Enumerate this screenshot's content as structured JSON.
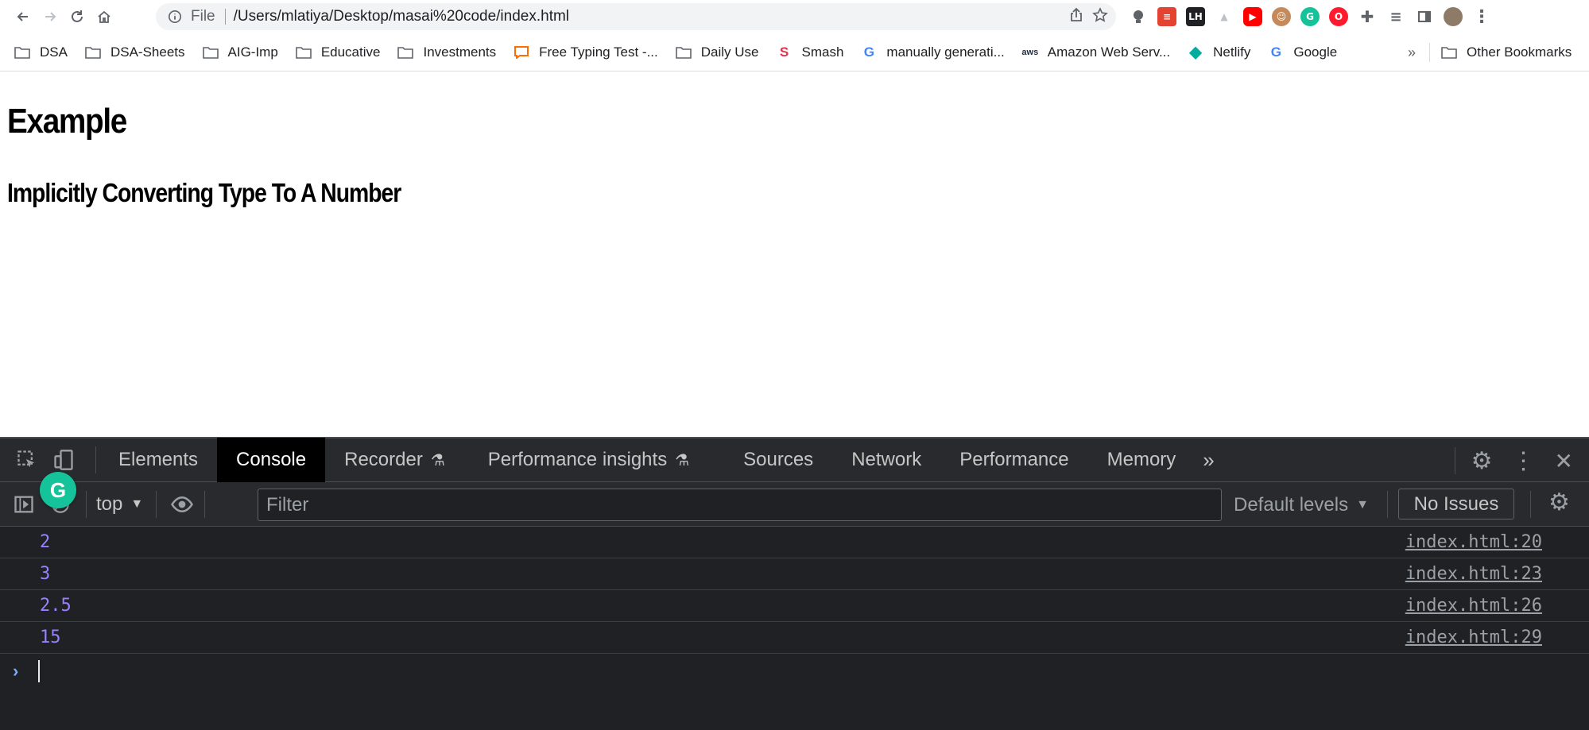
{
  "browser": {
    "omnibox": {
      "scheme_label": "File",
      "url": "/Users/mlatiya/Desktop/masai%20code/index.html"
    },
    "extensions": [
      {
        "icon": "lightbulb-icon",
        "color": "#5f6368"
      },
      {
        "icon": "todoist-icon",
        "color": "#e44332"
      },
      {
        "icon": "lighthouse-icon",
        "color": "#202124",
        "label": "LH"
      },
      {
        "icon": "drive-icon",
        "color": "#bdc1c6"
      },
      {
        "icon": "youtube-icon",
        "color": "#ff0000"
      },
      {
        "icon": "face-icon",
        "color": "#c58a5b"
      },
      {
        "icon": "grammarly-icon",
        "color": "#15c39a"
      },
      {
        "icon": "opera-icon",
        "color": "#ff1b2d"
      },
      {
        "icon": "puzzle-icon",
        "color": "#5f6368"
      },
      {
        "icon": "playlist-icon",
        "color": "#5f6368"
      },
      {
        "icon": "sidepanel-icon",
        "color": "#5f6368"
      }
    ]
  },
  "bookmarks": {
    "items": [
      {
        "label": "DSA",
        "icon": "folder-icon"
      },
      {
        "label": "DSA-Sheets",
        "icon": "folder-icon"
      },
      {
        "label": "AIG-Imp",
        "icon": "folder-icon"
      },
      {
        "label": "Educative",
        "icon": "folder-icon"
      },
      {
        "label": "Investments",
        "icon": "folder-icon"
      },
      {
        "label": "Free Typing Test -...",
        "icon": "chat-icon"
      },
      {
        "label": "Daily Use",
        "icon": "folder-icon"
      },
      {
        "label": "Smash",
        "icon": "smash-icon"
      },
      {
        "label": "manually generati...",
        "icon": "google-icon"
      },
      {
        "label": "Amazon Web Serv...",
        "icon": "aws-icon"
      },
      {
        "label": "Netlify",
        "icon": "netlify-icon"
      },
      {
        "label": "Google",
        "icon": "google-icon"
      }
    ],
    "more": "»",
    "other": "Other Bookmarks"
  },
  "page": {
    "heading": "Example",
    "subheading": "Implicitly Converting Type To A Number"
  },
  "devtools": {
    "tabs": [
      "Elements",
      "Console",
      "Recorder",
      "Performance insights",
      "Sources",
      "Network",
      "Performance",
      "Memory"
    ],
    "active_tab": "Console",
    "overflow": "»",
    "context": "top",
    "filter_placeholder": "Filter",
    "levels": "Default levels",
    "issues": "No Issues",
    "logs": [
      {
        "value": "2",
        "source": "index.html:20"
      },
      {
        "value": "3",
        "source": "index.html:23"
      },
      {
        "value": "2.5",
        "source": "index.html:26"
      },
      {
        "value": "15",
        "source": "index.html:29"
      }
    ],
    "prompt": "›"
  },
  "colors": {
    "devtools_bg": "#202124",
    "log_value": "#9980ff",
    "grammarly": "#15c39a"
  }
}
